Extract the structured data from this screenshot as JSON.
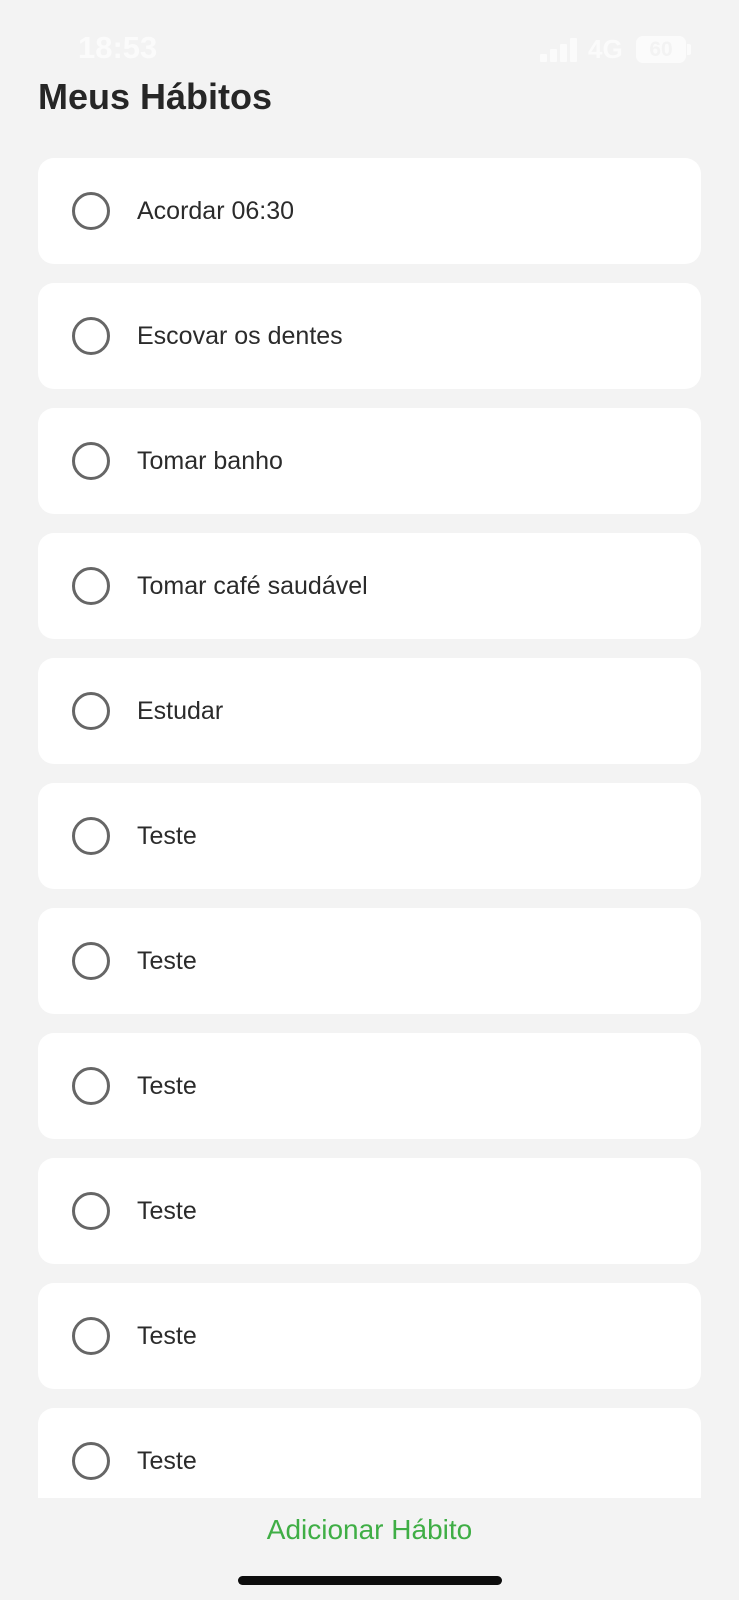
{
  "status_bar": {
    "time": "18:53",
    "network": "4G",
    "battery": "60"
  },
  "header": {
    "title": "Meus Hábitos"
  },
  "habits": [
    {
      "label": "Acordar 06:30",
      "done": false
    },
    {
      "label": "Escovar os dentes",
      "done": false
    },
    {
      "label": "Tomar banho",
      "done": false
    },
    {
      "label": "Tomar café saudável",
      "done": false
    },
    {
      "label": "Estudar",
      "done": false
    },
    {
      "label": "Teste",
      "done": false
    },
    {
      "label": "Teste",
      "done": false
    },
    {
      "label": "Teste",
      "done": false
    },
    {
      "label": "Teste",
      "done": false
    },
    {
      "label": "Teste",
      "done": false
    },
    {
      "label": "Teste",
      "done": false
    }
  ],
  "footer": {
    "add_label": "Adicionar Hábito"
  },
  "icons": {
    "checkbox": "circle-outline-icon",
    "signal": "signal-bars-icon",
    "battery": "battery-icon"
  },
  "colors": {
    "background": "#f3f3f3",
    "card": "#ffffff",
    "accent": "#3fae45",
    "text": "#2b2b2b",
    "checkbox_border": "#666666"
  }
}
